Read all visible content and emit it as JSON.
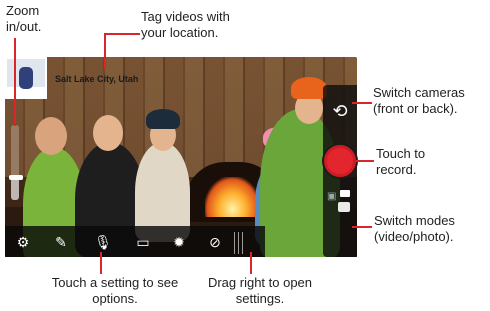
{
  "callouts": {
    "zoom": "Zoom in/out.",
    "tag": "Tag videos with your location.",
    "switch_cameras": "Switch cameras (front or back).",
    "record": "Touch to record.",
    "switch_modes": "Switch modes (video/photo).",
    "settings": "Touch a setting to see options.",
    "drag": "Drag right to open settings."
  },
  "location": {
    "text": "Salt Lake City, Utah"
  },
  "zoom": {
    "level": 0.3
  },
  "settings_icons": [
    "gear-icon",
    "effects-icon",
    "microphone-icon",
    "widescreen-icon",
    "brightness-icon",
    "location-icon"
  ],
  "accent": "#d9262b",
  "record_color": "#e3262e"
}
